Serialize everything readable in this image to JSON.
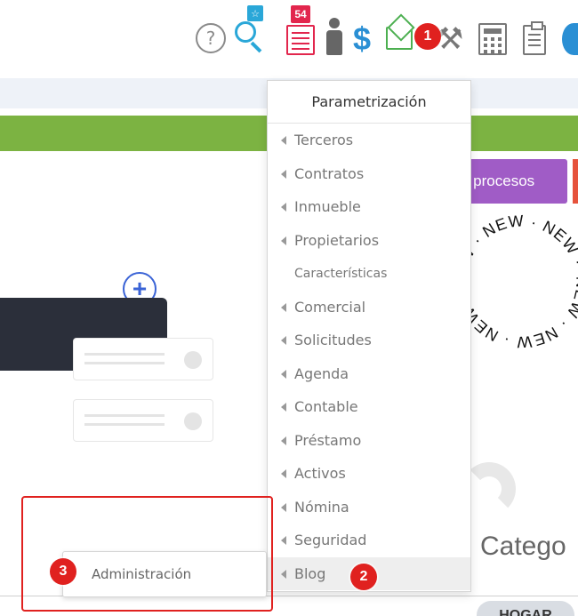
{
  "toolbar": {
    "search_badge": "☆",
    "doc_badge": "54",
    "dollar_symbol": "$",
    "help_symbol": "?"
  },
  "markers": {
    "one": "1",
    "two": "2",
    "three": "3"
  },
  "main": {
    "procesos_button": "e procesos",
    "stamp_text": "NEW · NEW · NEW · NEW · NEW · NEW ·",
    "category_heading": "Catego",
    "hogar_pill": "HOGAR"
  },
  "menu": {
    "header": "Parametrización",
    "items": [
      {
        "label": "Terceros",
        "caret": true
      },
      {
        "label": "Contratos",
        "caret": true
      },
      {
        "label": "Inmueble",
        "caret": true
      },
      {
        "label": "Propietarios",
        "caret": true
      },
      {
        "label": "Características",
        "caret": false
      },
      {
        "label": "Comercial",
        "caret": true
      },
      {
        "label": "Solicitudes",
        "caret": true
      },
      {
        "label": "Agenda",
        "caret": true
      },
      {
        "label": "Contable",
        "caret": true
      },
      {
        "label": "Préstamo",
        "caret": true
      },
      {
        "label": "Activos",
        "caret": true
      },
      {
        "label": "Nómina",
        "caret": true
      },
      {
        "label": "Seguridad",
        "caret": true
      },
      {
        "label": "Blog",
        "caret": true
      }
    ],
    "submenu_item": "Administración"
  },
  "colors": {
    "marker_red": "#e0211f",
    "green_bar": "#7cb342",
    "purple_button": "#a05cc6",
    "brand_blue": "#2a8fd4"
  }
}
